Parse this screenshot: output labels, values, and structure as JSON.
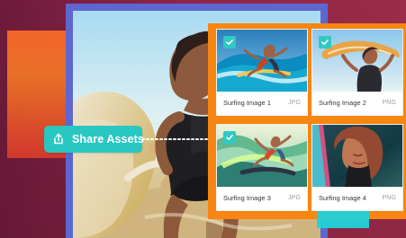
{
  "hero": {
    "share_button_label": "Share Assets",
    "share_icon": "share-icon",
    "main_image_icon": "woman-surfboard-photo"
  },
  "assets": [
    {
      "name": "Surfing Image 1",
      "format": "JPG",
      "selected": true,
      "icon": "surfer-wave-photo"
    },
    {
      "name": "Surfing Image 2",
      "format": "PNG",
      "selected": true,
      "icon": "woman-board-photo"
    },
    {
      "name": "Surfing Image 3",
      "format": "JPG",
      "selected": true,
      "icon": "surfer-splash-photo"
    },
    {
      "name": "Surfing Image 4",
      "format": "PNG",
      "selected": false,
      "icon": "portrait-photo"
    }
  ],
  "colors": {
    "background": "#8f2547",
    "accent_orange": "#f78612",
    "accent_teal": "#29c7c2",
    "frame_blue": "#5d67cf"
  }
}
